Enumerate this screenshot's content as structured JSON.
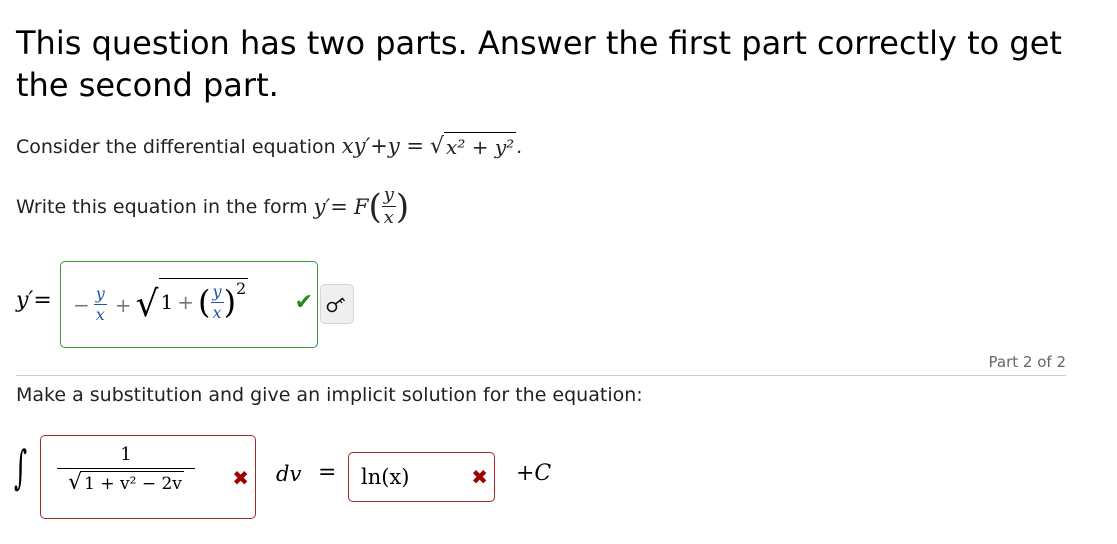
{
  "header": {
    "title": "This question has two parts. Answer the first part correctly to get the second part."
  },
  "part1": {
    "prompt_prefix": "Consider the differential equation",
    "equation": {
      "lhs": "xy′+y =",
      "rhs_radicand": "x² + y²",
      "end": "."
    },
    "instruction_prefix": "Write this equation in the form",
    "form": {
      "lhs": "y′=",
      "func": "F",
      "num": "y",
      "den": "x"
    },
    "answer_label": "y′=",
    "answer": {
      "sign": "−",
      "num": "y",
      "den": "x",
      "plus": "+",
      "one": "1",
      "plus2": "+",
      "inner_num": "y",
      "inner_den": "x",
      "exponent": "2",
      "status": "correct"
    },
    "key_button": "key-icon"
  },
  "part2": {
    "part_label": "Part 2 of 2",
    "prompt": "Make a substitution and give an implicit solution for the equation:",
    "integral_answer": {
      "num": "1",
      "radicand": "1 + v² − 2v",
      "status": "incorrect"
    },
    "dv_label": "dv",
    "equals": "=",
    "rhs_answer": {
      "value": "ln(x)",
      "status": "incorrect"
    },
    "constant": "+C"
  },
  "colors": {
    "correct": "#3a9a3a",
    "incorrect": "#a52a2a",
    "checkmark": "#228b22",
    "cross": "#a00000"
  }
}
